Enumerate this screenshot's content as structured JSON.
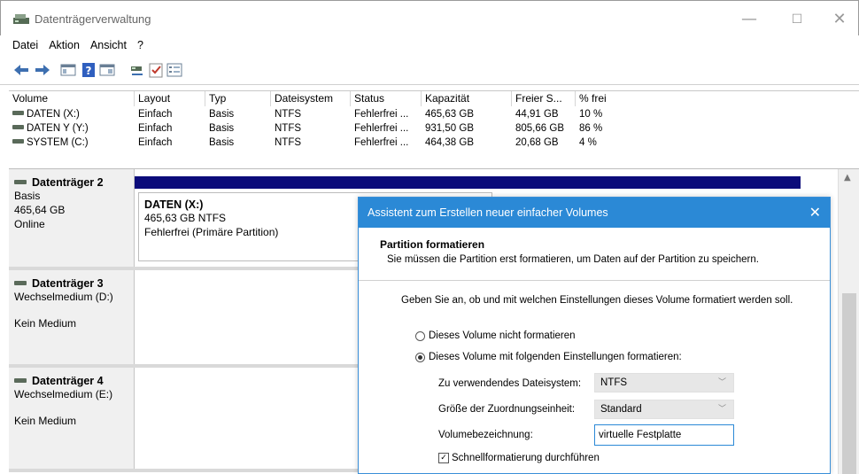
{
  "window": {
    "title": "Datenträgerverwaltung",
    "controls": {
      "minimize": "—",
      "maximize": "☐",
      "close": "✕"
    }
  },
  "menu": [
    "Datei",
    "Aktion",
    "Ansicht",
    "?"
  ],
  "toolbar": {
    "icons": [
      "back-arrow-icon",
      "forward-arrow-icon",
      "console-tree-icon",
      "help-icon",
      "properties-icon",
      "connect-icon",
      "checklist-icon",
      "list-view-icon"
    ]
  },
  "volume_table": {
    "columns": [
      "Volume",
      "Layout",
      "Typ",
      "Dateisystem",
      "Status",
      "Kapazität",
      "Freier S...",
      "% frei"
    ],
    "rows": [
      [
        "DATEN (X:)",
        "Einfach",
        "Basis",
        "NTFS",
        "Fehlerfrei ...",
        "465,63 GB",
        "44,91 GB",
        "10 %"
      ],
      [
        "DATEN Y (Y:)",
        "Einfach",
        "Basis",
        "NTFS",
        "Fehlerfrei ...",
        "931,50 GB",
        "805,66 GB",
        "86 %"
      ],
      [
        "SYSTEM (C:)",
        "Einfach",
        "Basis",
        "NTFS",
        "Fehlerfrei ...",
        "464,38 GB",
        "20,68 GB",
        "4 %"
      ]
    ]
  },
  "disks": [
    {
      "name": "Datenträger 2",
      "line1": "Basis",
      "line2": "465,64 GB",
      "line3": "Online"
    },
    {
      "name": "Datenträger 3",
      "line1": "Wechselmedium (D:)",
      "line2": "",
      "line3": "Kein Medium"
    },
    {
      "name": "Datenträger 4",
      "line1": "Wechselmedium (E:)",
      "line2": "",
      "line3": "Kein Medium"
    }
  ],
  "partition": {
    "title": "DATEN  (X:)",
    "size": "465,63 GB NTFS",
    "status": "Fehlerfrei (Primäre Partition)"
  },
  "dialog": {
    "title": "Assistent zum Erstellen neuer einfacher Volumes",
    "close": "✕",
    "header_title": "Partition formatieren",
    "header_sub": "Sie müssen die Partition erst formatieren, um Daten auf der Partition zu speichern.",
    "intro": "Geben Sie an, ob und mit welchen Einstellungen dieses Volume formatiert werden soll.",
    "radio_no_format": "Dieses Volume nicht formatieren",
    "radio_format": "Dieses Volume mit folgenden Einstellungen formatieren:",
    "fs_label": "Zu verwendendes Dateisystem:",
    "fs_value": "NTFS",
    "alloc_label": "Größe der Zuordnungseinheit:",
    "alloc_value": "Standard",
    "vol_label": "Volumebezeichnung:",
    "vol_value": "virtuelle Festplatte",
    "quick_format": "Schnellformatierung durchführen",
    "check_mark": "✓"
  }
}
